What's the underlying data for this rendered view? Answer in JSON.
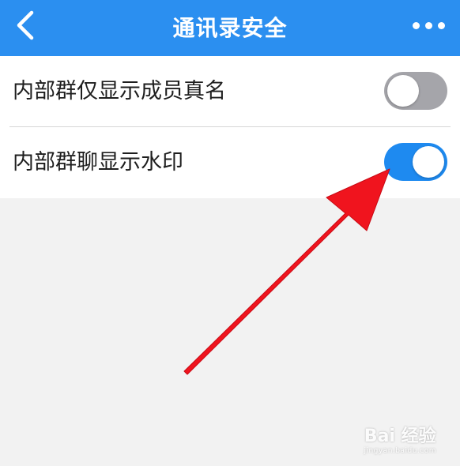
{
  "header": {
    "title": "通讯录安全",
    "back_icon": "chevron-left-icon",
    "more_icon": "more-horizontal-icon",
    "background": "#2b8ff0"
  },
  "settings": [
    {
      "label": "内部群仅显示成员真名",
      "enabled": false
    },
    {
      "label": "内部群聊显示水印",
      "enabled": true
    }
  ],
  "annotation": {
    "arrow_color": "#f0141e",
    "arrow_icon": "red-arrow-pointer"
  },
  "watermark": {
    "main": "Bai 经验",
    "sub": "jingyan.baidu.com"
  },
  "colors": {
    "toggle_on": "#1e8af0",
    "toggle_off": "#a5a5aa",
    "page_background": "#f2f2f2"
  }
}
